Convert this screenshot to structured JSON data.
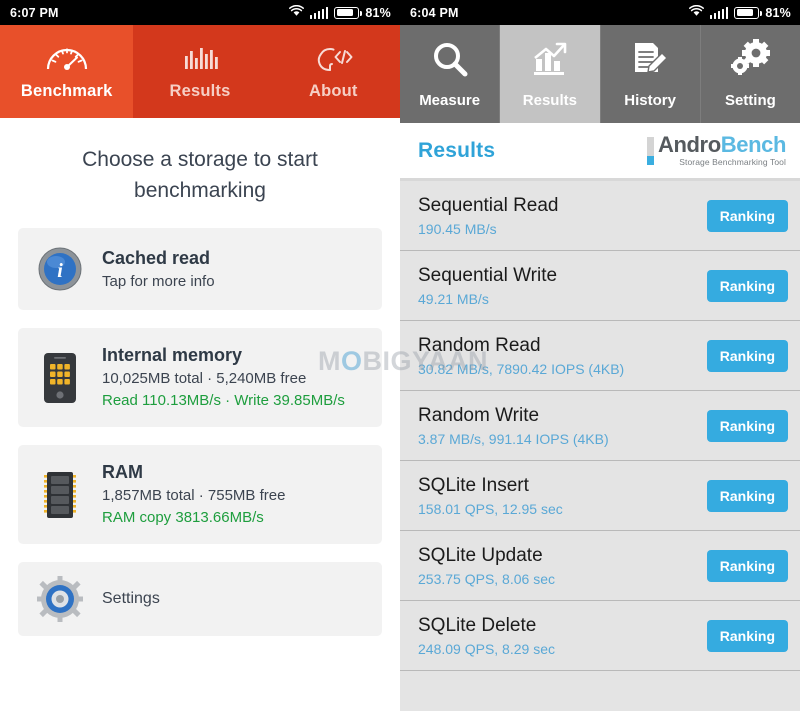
{
  "left_screen": {
    "status_bar": {
      "time": "6:07 PM",
      "battery_percent": "81%",
      "icons": [
        "wifi-icon",
        "signal-bars-icon",
        "battery-icon"
      ]
    },
    "tabs": [
      {
        "label": "Benchmark",
        "icon": "speedometer-icon",
        "active": true
      },
      {
        "label": "Results",
        "icon": "bar-chart-icon",
        "active": false
      },
      {
        "label": "About",
        "icon": "head-code-icon",
        "active": false
      }
    ],
    "heading": "Choose a storage to start benchmarking",
    "cards": [
      {
        "icon": "info-circle-icon",
        "title": "Cached read",
        "subtitle": "Tap for more info",
        "speed": ""
      },
      {
        "icon": "phone-icon",
        "title": "Internal memory",
        "subtitle": "10,025MB total · 5,240MB free",
        "speed": "Read 110.13MB/s · Write 39.85MB/s"
      },
      {
        "icon": "ram-chip-icon",
        "title": "RAM",
        "subtitle": "1,857MB total · 755MB free",
        "speed": "RAM copy 3813.66MB/s"
      }
    ],
    "settings": {
      "icon": "gear-icon",
      "label": "Settings"
    },
    "colors": {
      "header_active": "#e8502a",
      "header_inactive": "#d3381c",
      "speed_text": "#1e9e3e"
    }
  },
  "right_screen": {
    "status_bar": {
      "time": "6:04 PM",
      "battery_percent": "81%",
      "icons": [
        "wifi-icon",
        "signal-bars-icon",
        "battery-icon"
      ]
    },
    "tabs": [
      {
        "label": "Measure",
        "icon": "magnifier-icon",
        "active": false
      },
      {
        "label": "Results",
        "icon": "chart-arrow-icon",
        "active": true
      },
      {
        "label": "History",
        "icon": "document-pencil-icon",
        "active": false
      },
      {
        "label": "Setting",
        "icon": "gears-icon",
        "active": false
      }
    ],
    "page_title": "Results",
    "logo": {
      "name_part1": "Andro",
      "name_part2": "Bench",
      "tagline": "Storage Benchmarking Tool"
    },
    "ranking_label": "Ranking",
    "results": [
      {
        "name": "Sequential Read",
        "value": "190.45 MB/s"
      },
      {
        "name": "Sequential Write",
        "value": "49.21 MB/s"
      },
      {
        "name": "Random Read",
        "value": "30.82 MB/s, 7890.42 IOPS (4KB)"
      },
      {
        "name": "Random Write",
        "value": "3.87 MB/s, 991.14 IOPS (4KB)"
      },
      {
        "name": "SQLite Insert",
        "value": "158.01 QPS, 12.95 sec"
      },
      {
        "name": "SQLite Update",
        "value": "253.75 QPS, 8.06 sec"
      },
      {
        "name": "SQLite Delete",
        "value": "248.09 QPS, 8.29 sec"
      }
    ],
    "colors": {
      "tab_active": "#c3c3c3",
      "tab_inactive": "#6d6d6d",
      "accent": "#35abe0",
      "list_bg": "#e4e4e4"
    }
  },
  "watermark": {
    "part1": "M",
    "part2": "O",
    "part3": "BIGYAAN"
  }
}
